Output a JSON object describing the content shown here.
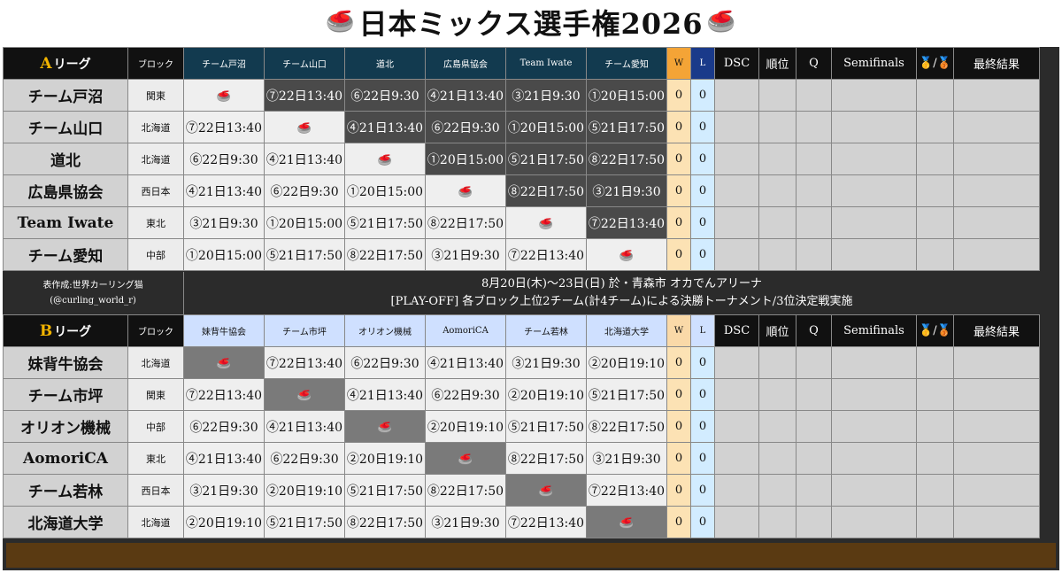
{
  "title": "日本ミックス選手権2026",
  "icons": {
    "stone": "curling-stone-icon",
    "medal": "medal-icon"
  },
  "stone_glyph": "🥌",
  "headers": {
    "block": "ブロック",
    "w": "W",
    "l": "L",
    "dsc": "DSC",
    "rank": "順位",
    "q": "Q",
    "semifinals": "Semifinals",
    "medal": "🥇/🥉",
    "final": "最終結果"
  },
  "league_a": {
    "letter": "A",
    "label": "リーグ",
    "opponents": [
      "チーム戸沼",
      "チーム山口",
      "道北",
      "広島県協会",
      "Team Iwate",
      "チーム愛知"
    ],
    "rows": [
      {
        "team": "チーム戸沼",
        "block": "関東",
        "matches": [
          "",
          "⑦22日13:40",
          "⑥22日9:30",
          "④21日13:40",
          "③21日9:30",
          "①20日15:00"
        ],
        "w": "0",
        "l": "0"
      },
      {
        "team": "チーム山口",
        "block": "北海道",
        "matches": [
          "⑦22日13:40",
          "",
          "④21日13:40",
          "⑥22日9:30",
          "①20日15:00",
          "⑤21日17:50"
        ],
        "w": "0",
        "l": "0"
      },
      {
        "team": "道北",
        "block": "北海道",
        "matches": [
          "⑥22日9:30",
          "④21日13:40",
          "",
          "①20日15:00",
          "⑤21日17:50",
          "⑧22日17:50"
        ],
        "w": "0",
        "l": "0"
      },
      {
        "team": "広島県協会",
        "block": "西日本",
        "matches": [
          "④21日13:40",
          "⑥22日9:30",
          "①20日15:00",
          "",
          "⑧22日17:50",
          "③21日9:30"
        ],
        "w": "0",
        "l": "0"
      },
      {
        "team": "Team Iwate",
        "block": "東北",
        "matches": [
          "③21日9:30",
          "①20日15:00",
          "⑤21日17:50",
          "⑧22日17:50",
          "",
          "⑦22日13:40"
        ],
        "w": "0",
        "l": "0"
      },
      {
        "team": "チーム愛知",
        "block": "中部",
        "matches": [
          "①20日15:00",
          "⑤21日17:50",
          "⑧22日17:50",
          "③21日9:30",
          "⑦22日13:40",
          ""
        ],
        "w": "0",
        "l": "0"
      }
    ]
  },
  "middle": {
    "credit_line1": "表作成:世界カーリング猫",
    "credit_line2": "(@curling_world_r)",
    "info_line1": "8月20日(木)〜23日(日) 於・青森市 オカでんアリーナ",
    "info_line2": "[PLAY-OFF] 各ブロック上位2チーム(計4チーム)による決勝トーナメント/3位決定戦実施"
  },
  "league_b": {
    "letter": "B",
    "label": "リーグ",
    "opponents": [
      "妹背牛協会",
      "チーム市坪",
      "オリオン機械",
      "AomoriCA",
      "チーム若林",
      "北海道大学"
    ],
    "rows": [
      {
        "team": "妹背牛協会",
        "block": "北海道",
        "matches": [
          "",
          "⑦22日13:40",
          "⑥22日9:30",
          "④21日13:40",
          "③21日9:30",
          "②20日19:10"
        ],
        "w": "0",
        "l": "0"
      },
      {
        "team": "チーム市坪",
        "block": "関東",
        "matches": [
          "⑦22日13:40",
          "",
          "④21日13:40",
          "⑥22日9:30",
          "②20日19:10",
          "⑤21日17:50"
        ],
        "w": "0",
        "l": "0"
      },
      {
        "team": "オリオン機械",
        "block": "中部",
        "matches": [
          "⑥22日9:30",
          "④21日13:40",
          "",
          "②20日19:10",
          "⑤21日17:50",
          "⑧22日17:50"
        ],
        "w": "0",
        "l": "0"
      },
      {
        "team": "AomoriCA",
        "block": "東北",
        "matches": [
          "④21日13:40",
          "⑥22日9:30",
          "②20日19:10",
          "",
          "⑧22日17:50",
          "③21日9:30"
        ],
        "w": "0",
        "l": "0"
      },
      {
        "team": "チーム若林",
        "block": "西日本",
        "matches": [
          "③21日9:30",
          "②20日19:10",
          "⑤21日17:50",
          "⑧22日17:50",
          "",
          "⑦22日13:40"
        ],
        "w": "0",
        "l": "0"
      },
      {
        "team": "北海道大学",
        "block": "北海道",
        "matches": [
          "②20日19:10",
          "⑤21日17:50",
          "⑧22日17:50",
          "③21日9:30",
          "⑦22日13:40",
          ""
        ],
        "w": "0",
        "l": "0"
      }
    ]
  }
}
